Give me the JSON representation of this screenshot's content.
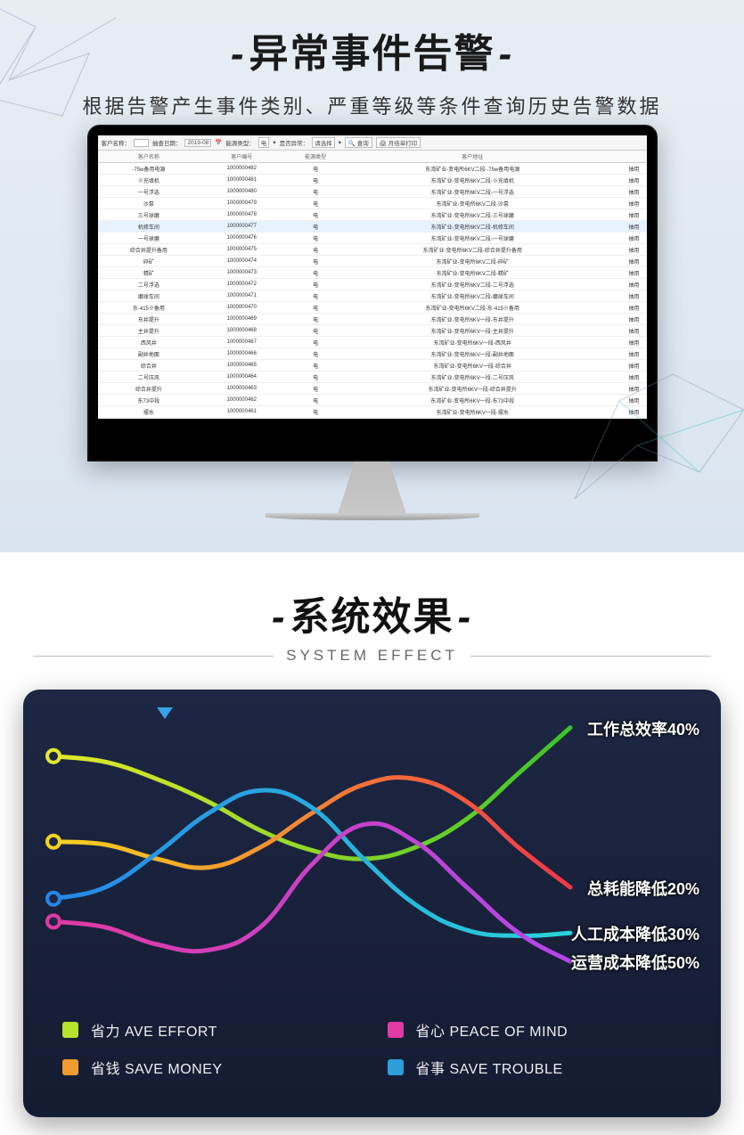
{
  "section1": {
    "title": "异常事件告警",
    "subtitle": "根据告警产生事件类别、严重等级等条件查询历史告警数据"
  },
  "toolbar": {
    "l_customer": "客户名称：",
    "l_date": "抽查日期：",
    "date_val": "2019-08",
    "l_energy_type": "能源类型：",
    "energy_val": "电",
    "l_anomaly": "是否异常：",
    "anomaly_val": "请选择",
    "btn_query": "查询",
    "btn_print": "月结单打印"
  },
  "table": {
    "headers": [
      "客户名称",
      "客户编号",
      "能源类型",
      "客户地址",
      ""
    ],
    "rows": [
      {
        "c1": "-75w备用电源",
        "c2": "1000000482",
        "c3": "电",
        "c4": "东湾矿业-变电所6KV二段-.75w备用电源",
        "c5": "抽用",
        "hl": false
      },
      {
        "c1": "※充填机",
        "c2": "1000000481",
        "c3": "电",
        "c4": "东湾矿业-变电所6KV二段-※充填机",
        "c5": "抽用",
        "hl": false
      },
      {
        "c1": "一号浮选",
        "c2": "1000000480",
        "c3": "电",
        "c4": "东湾矿业-变电所6KV二段-一号浮选",
        "c5": "抽用",
        "hl": false
      },
      {
        "c1": "沙泵",
        "c2": "1000000479",
        "c3": "电",
        "c4": "东湾矿业-变电所6KV二段-沙泵",
        "c5": "抽用",
        "hl": false
      },
      {
        "c1": "三号球磨",
        "c2": "1000000478",
        "c3": "电",
        "c4": "东湾矿业-变电所6KV二段-三号球磨",
        "c5": "抽用",
        "hl": false
      },
      {
        "c1": "机修车间",
        "c2": "1000000477",
        "c3": "电",
        "c4": "东湾矿业-变电所6KV二段-机修车间",
        "c5": "抽用",
        "hl": true
      },
      {
        "c1": "一号球磨",
        "c2": "1000000476",
        "c3": "电",
        "c4": "东湾矿业-变电所6KV二段-一号球磨",
        "c5": "抽用",
        "hl": false
      },
      {
        "c1": "综合井提升备用",
        "c2": "1000000475",
        "c3": "电",
        "c4": "东湾矿业-变电所6KV二段-综合井提升备用",
        "c5": "抽用",
        "hl": false
      },
      {
        "c1": "碎矿",
        "c2": "1000000474",
        "c3": "电",
        "c4": "东湾矿业-变电所6KV二段-碎矿",
        "c5": "抽用",
        "hl": false
      },
      {
        "c1": "精矿",
        "c2": "1000000473",
        "c3": "电",
        "c4": "东湾矿业-变电所6KV二段-精矿",
        "c5": "抽用",
        "hl": false
      },
      {
        "c1": "二号浮选",
        "c2": "1000000472",
        "c3": "电",
        "c4": "东湾矿业-变电所6KV二段-二号浮选",
        "c5": "抽用",
        "hl": false
      },
      {
        "c1": "磨球车间",
        "c2": "1000000471",
        "c3": "电",
        "c4": "东湾矿业-变电所6KV二段-磨球车间",
        "c5": "抽用",
        "hl": false
      },
      {
        "c1": "东-415※备用",
        "c2": "1000000470",
        "c3": "电",
        "c4": "东湾矿业-变电所6KV二段-东-415※备用",
        "c5": "抽用",
        "hl": false
      },
      {
        "c1": "东井提升",
        "c2": "1000000469",
        "c3": "电",
        "c4": "东湾矿业-变电所6KV一段-东井提升",
        "c5": "抽用",
        "hl": false
      },
      {
        "c1": "主井提升",
        "c2": "1000000468",
        "c3": "电",
        "c4": "东湾矿业-变电所6KV一段-主井提升",
        "c5": "抽用",
        "hl": false
      },
      {
        "c1": "西风井",
        "c2": "1000000467",
        "c3": "电",
        "c4": "东湾矿业-变电所6KV一段-西风井",
        "c5": "抽用",
        "hl": false
      },
      {
        "c1": "副井地面",
        "c2": "1000000466",
        "c3": "电",
        "c4": "东湾矿业-变电所6KV一段-副井地面",
        "c5": "抽用",
        "hl": false
      },
      {
        "c1": "综合井",
        "c2": "1000000465",
        "c3": "电",
        "c4": "东湾矿业-变电所6KV一段-综合井",
        "c5": "抽用",
        "hl": false
      },
      {
        "c1": "二号压风",
        "c2": "1000000464",
        "c3": "电",
        "c4": "东湾矿业-变电所6KV一段-二号压风",
        "c5": "抽用",
        "hl": false
      },
      {
        "c1": "综合井提升",
        "c2": "1000000463",
        "c3": "电",
        "c4": "东湾矿业-变电所6KV一段-综合井提升",
        "c5": "抽用",
        "hl": false
      },
      {
        "c1": "东73中段",
        "c2": "1000000462",
        "c3": "电",
        "c4": "东湾矿业-变电所6KV一段-东73中段",
        "c5": "抽用",
        "hl": false
      },
      {
        "c1": "摆水",
        "c2": "1000000461",
        "c3": "电",
        "c4": "东湾矿业-变电所6KV一段-摆水",
        "c5": "抽用",
        "hl": false
      }
    ]
  },
  "section2": {
    "title": "系统效果",
    "subtitle_en": "SYSTEM EFFECT"
  },
  "chart_data": {
    "type": "line",
    "x": [
      0,
      1,
      2,
      3,
      4,
      5,
      6,
      7,
      8,
      9,
      10
    ],
    "series": [
      {
        "name": "省力 AVE EFFORT",
        "color_start": "#e4e92a",
        "color_end": "#3dc42a",
        "end_label": "工作总效率40%",
        "values": [
          86,
          84,
          78,
          70,
          60,
          53,
          50,
          54,
          64,
          80,
          96
        ]
      },
      {
        "name": "省钱 SAVE MONEY",
        "color_start": "#f5d321",
        "color_end": "#f23548",
        "end_label": "总耗能降低20%",
        "values": [
          56,
          55,
          50,
          47,
          54,
          66,
          76,
          78,
          70,
          54,
          40
        ]
      },
      {
        "name": "省事 SAVE TROUBLE",
        "color_start": "#2686e6",
        "color_end": "#28d3d8",
        "end_label": "人工成本降低30%",
        "values": [
          36,
          40,
          52,
          66,
          74,
          68,
          50,
          34,
          25,
          23,
          24
        ]
      },
      {
        "name": "省心 PEACE OF MIND",
        "color_start": "#e13aa3",
        "color_end": "#b247e8",
        "end_label": "运营成本降低50%",
        "values": [
          28,
          26,
          20,
          18,
          26,
          48,
          62,
          56,
          40,
          24,
          14
        ]
      }
    ],
    "ylim": [
      0,
      100
    ],
    "legend": [
      {
        "label": "省力 AVE EFFORT",
        "color": "#b5e22a"
      },
      {
        "label": "省心 PEACE OF MIND",
        "color": "#e13aa3"
      },
      {
        "label": "省钱 SAVE MONEY",
        "color": "#f29a2d"
      },
      {
        "label": "省事 SAVE TROUBLE",
        "color": "#2d9ed8"
      }
    ]
  }
}
